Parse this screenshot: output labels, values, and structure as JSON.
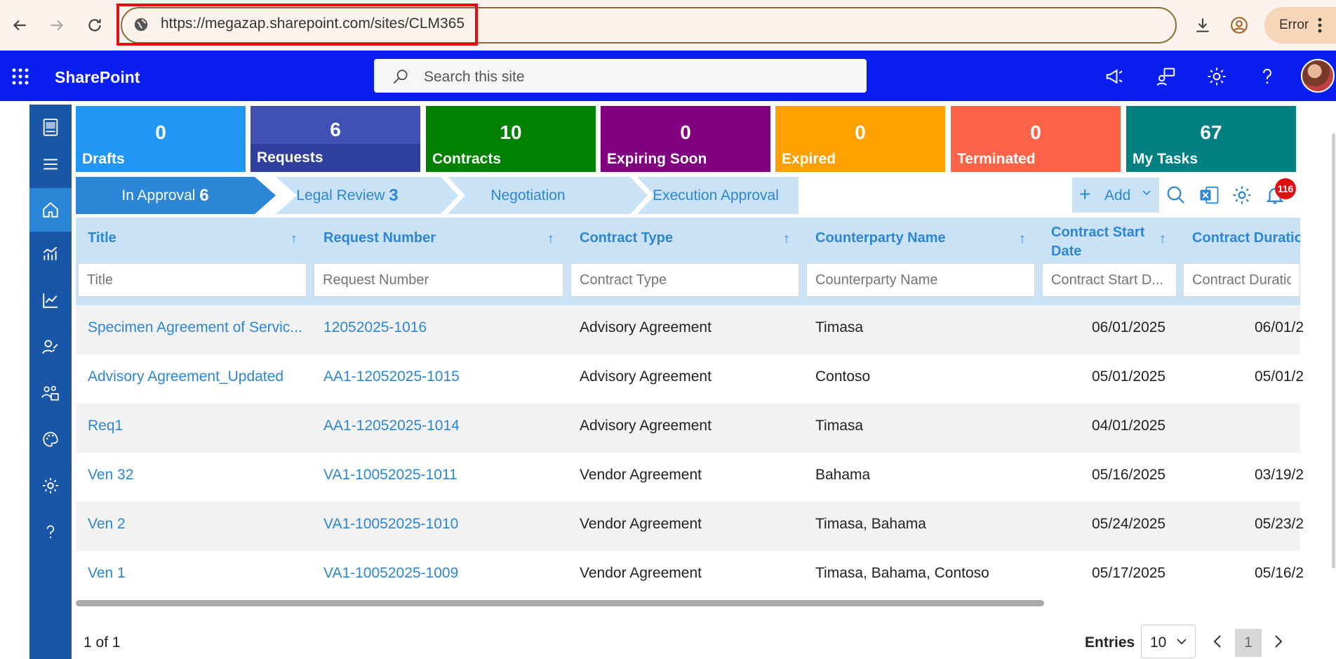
{
  "browser": {
    "url": "https://megazap.sharepoint.com/sites/CLM365",
    "error_label": "Error"
  },
  "sharepoint": {
    "app_title": "SharePoint",
    "search_placeholder": "Search this site"
  },
  "tiles": [
    {
      "count": "0",
      "label": "Drafts",
      "color": "#2196f3"
    },
    {
      "count": "6",
      "label": "Requests",
      "color": "#3f51b5"
    },
    {
      "count": "10",
      "label": "Contracts",
      "color": "#008000"
    },
    {
      "count": "0",
      "label": "Expiring Soon",
      "color": "#800080"
    },
    {
      "count": "0",
      "label": "Expired",
      "color": "#ffa000"
    },
    {
      "count": "0",
      "label": "Terminated",
      "color": "#ff6347"
    },
    {
      "count": "67",
      "label": "My Tasks",
      "color": "#008080"
    }
  ],
  "stages": [
    {
      "label": "In Approval",
      "count": "6"
    },
    {
      "label": "Legal Review",
      "count": "3"
    },
    {
      "label": "Negotiation",
      "count": ""
    },
    {
      "label": "Execution Approval",
      "count": ""
    }
  ],
  "toolbar": {
    "add_label": "Add",
    "notification_count": "116"
  },
  "table": {
    "columns": [
      "Title",
      "Request Number",
      "Contract Type",
      "Counterparty Name",
      "Contract Start Date",
      "Contract Duration"
    ],
    "filter_placeholders": [
      "Title",
      "Request Number",
      "Contract Type",
      "Counterparty Name",
      "Contract Start D...",
      "Contract Duratio"
    ],
    "rows": [
      {
        "title": "Specimen Agreement of Servic...",
        "request_number": "12052025-1016",
        "contract_type": "Advisory Agreement",
        "counterparty": "Timasa",
        "start_date": "06/01/2025",
        "duration": "06/01/2"
      },
      {
        "title": "Advisory Agreement_Updated",
        "request_number": "AA1-12052025-1015",
        "contract_type": "Advisory Agreement",
        "counterparty": "Contoso",
        "start_date": "05/01/2025",
        "duration": "05/01/2"
      },
      {
        "title": "Req1",
        "request_number": "AA1-12052025-1014",
        "contract_type": "Advisory Agreement",
        "counterparty": "Timasa",
        "start_date": "04/01/2025",
        "duration": ""
      },
      {
        "title": "Ven 32",
        "request_number": "VA1-10052025-1011",
        "contract_type": "Vendor Agreement",
        "counterparty": "Bahama",
        "start_date": "05/16/2025",
        "duration": "03/19/2"
      },
      {
        "title": "Ven 2",
        "request_number": "VA1-10052025-1010",
        "contract_type": "Vendor Agreement",
        "counterparty": "Timasa, Bahama",
        "start_date": "05/24/2025",
        "duration": "05/23/2"
      },
      {
        "title": "Ven 1",
        "request_number": "VA1-10052025-1009",
        "contract_type": "Vendor Agreement",
        "counterparty": "Timasa, Bahama, Contoso",
        "start_date": "05/17/2025",
        "duration": "05/16/2"
      }
    ]
  },
  "footer": {
    "page_info": "1 of 1",
    "entries_label": "Entries",
    "entries_value": "10",
    "current_page": "1"
  }
}
